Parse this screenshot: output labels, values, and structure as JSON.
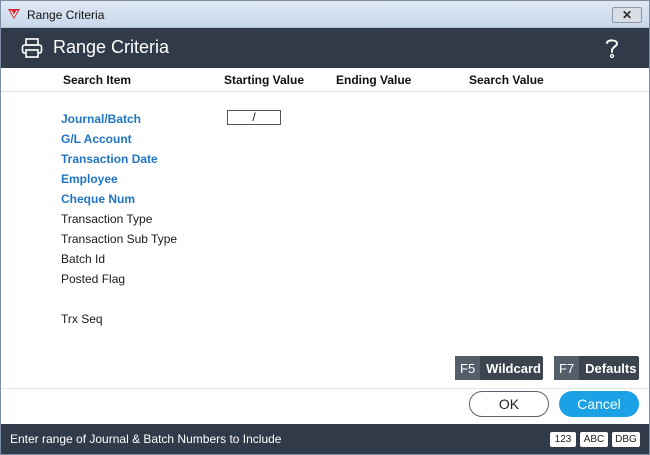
{
  "window": {
    "title": "Range Criteria",
    "close_glyph": "✕"
  },
  "header": {
    "title": "Range Criteria",
    "icon": "printer-icon",
    "help_icon": "help-icon"
  },
  "columns": {
    "search_item": "Search Item",
    "starting_value": "Starting Value",
    "ending_value": "Ending Value",
    "search_value": "Search Value"
  },
  "rows": [
    {
      "label": "Journal/Batch",
      "highlighted": true,
      "start_value": "/"
    },
    {
      "label": "G/L Account",
      "highlighted": true
    },
    {
      "label": "Transaction Date",
      "highlighted": true
    },
    {
      "label": "Employee",
      "highlighted": true
    },
    {
      "label": "Cheque Num",
      "highlighted": true
    },
    {
      "label": "Transaction Type",
      "highlighted": false
    },
    {
      "label": "Transaction Sub Type",
      "highlighted": false
    },
    {
      "label": "Batch Id",
      "highlighted": false
    },
    {
      "label": "Posted Flag",
      "highlighted": false
    },
    {
      "label": "Trx Seq",
      "highlighted": false
    }
  ],
  "function_keys": {
    "wildcard": {
      "key": "F5",
      "label": "Wildcard"
    },
    "defaults": {
      "key": "F7",
      "label": "Defaults"
    }
  },
  "buttons": {
    "ok": "OK",
    "cancel": "Cancel"
  },
  "status": {
    "message": "Enter range of Journal & Batch Numbers to Include",
    "badges": [
      "123",
      "ABC",
      "DBG"
    ]
  },
  "colors": {
    "header_bg": "#303a48",
    "highlight_label": "#1f75c4",
    "cancel_button": "#1ba1e6"
  }
}
